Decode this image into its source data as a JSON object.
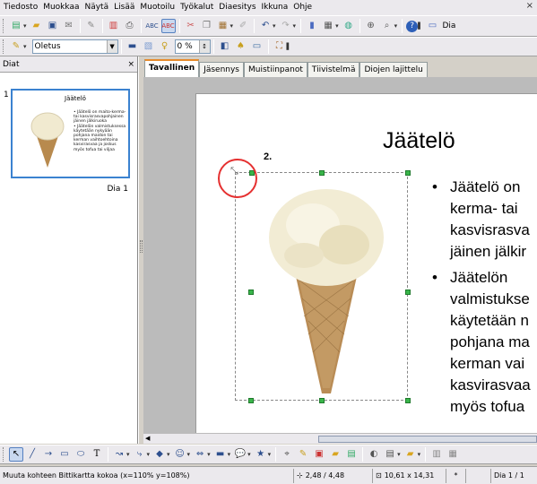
{
  "menu": {
    "items": [
      "Tiedosto",
      "Muokkaa",
      "Näytä",
      "Lisää",
      "Muotoilu",
      "Työkalut",
      "Diaesitys",
      "Ikkuna",
      "Ohje"
    ],
    "close": "×"
  },
  "toolbar": {
    "dia_label": "Dia",
    "style_value": "Oletus",
    "percent_value": "0 %"
  },
  "slides_pane": {
    "title": "Diat",
    "close": "×",
    "thumb_number": "1",
    "thumb_label": "Dia 1",
    "thumb_title": "Jäätelö",
    "thumb_text": "• Jäätelö on maito-kerma- tai kasvisrasvapohjainen jäinen jälkiruoka\n• Jäätelön valmistuksessa käytetään nykyään pohjana maidon tai kerman vaihtoehtoina kasvirasvaa ja joskus myös tofua tai viljaa"
  },
  "tabs": [
    "Tavallinen",
    "Jäsennys",
    "Muistiinpanot",
    "Tiivistelmä",
    "Diojen lajittelu"
  ],
  "slide": {
    "title": "Jäätelö",
    "bullets": [
      "Jäätelö on\nkerma- tai\nkasvisrasva\njäinen jälkir",
      "Jäätelön\nvalmistukse\nkäytetään n\npohjana ma\nkerman vai\nkasvirasvaa\nmyös tofua"
    ],
    "step_label": "2."
  },
  "status": {
    "message": "Muuta kohteen Bittikartta kokoa (x=110% y=108%)",
    "position": "2,48 / 4,48",
    "size": "10,61 x 14,31",
    "star": "*",
    "slide_info": "Dia 1 / 1"
  },
  "colors": {
    "accent_tab": "#e68b2c",
    "selection_handle": "#39b54a",
    "highlight_circle": "#e53030",
    "thumb_border": "#3b82d0"
  }
}
